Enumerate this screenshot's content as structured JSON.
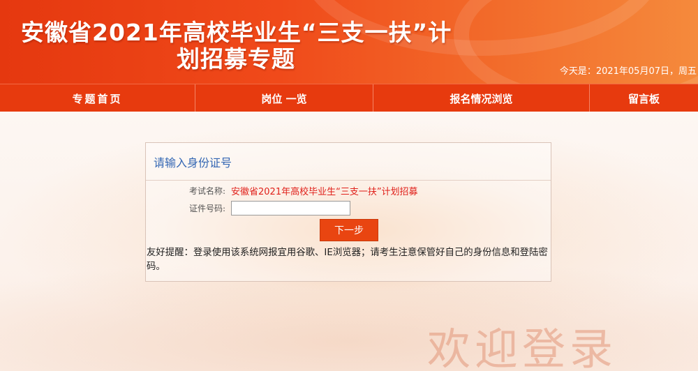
{
  "header": {
    "title_line1": "安徽省2021年高校毕业生“三支一扶”计",
    "title_line2": "划招募专题",
    "date": "今天是：2021年05月07日，周五"
  },
  "nav": {
    "items": [
      {
        "label": "专题首页"
      },
      {
        "label": "岗位 一览"
      },
      {
        "label": "报名情况浏览"
      },
      {
        "label": "留言板"
      }
    ]
  },
  "login": {
    "heading": "请输入身份证号",
    "exam_label": "考试名称:",
    "exam_value": "安徽省2021年高校毕业生“三支一扶”计划招募",
    "id_label": "证件号码:",
    "id_value": "",
    "id_placeholder": "",
    "next_button": "下一步",
    "tip": "友好提醒：登录使用该系统网报宜用谷歌、IE浏览器；请考生注意保管好自己的身份信息和登陆密码。"
  },
  "background": {
    "watermark_text": "欢迎登录"
  },
  "colors": {
    "banner": "#e5380f",
    "nav": "#e73a0e",
    "heading_text": "#3366b3",
    "exam_value_text": "#e0201a",
    "button": "#e94511"
  }
}
